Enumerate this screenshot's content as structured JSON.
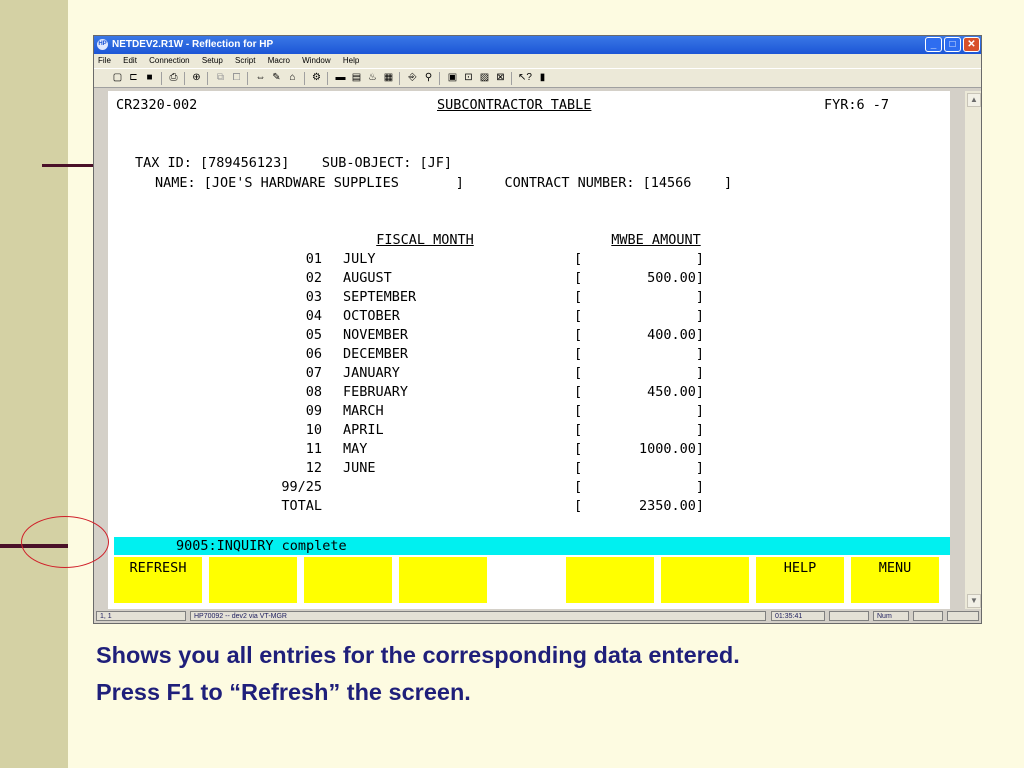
{
  "window": {
    "title": "NETDEV2.R1W - Reflection for HP",
    "app_icon_label": "HP",
    "minimize": "_",
    "maximize": "□",
    "close": "✕"
  },
  "menubar": [
    "File",
    "Edit",
    "Connection",
    "Setup",
    "Script",
    "Macro",
    "Window",
    "Help"
  ],
  "toolbar_icons": [
    "new-icon",
    "open-icon",
    "save-icon",
    "print-icon",
    "find-icon",
    "copy-icon",
    "paste-icon",
    "connect-icon",
    "transfer-icon",
    "receive-icon",
    "settings-icon",
    "display-icon",
    "keyboard-icon",
    "network-icon",
    "hide-icon",
    "macro-icon",
    "record-icon",
    "terminal-icon",
    "screen-icon",
    "help-icon",
    "book-icon"
  ],
  "screen": {
    "screen_id": "CR2320-002",
    "screen_title": "SUBCONTRACTOR TABLE",
    "fyr": "FYR:6 -7",
    "tax_id_line": "TAX ID: [789456123]    SUB-OBJECT: [JF]",
    "name_line": "NAME: [JOE'S HARDWARE SUPPLIES       ]     CONTRACT NUMBER: [14566    ]",
    "col_header_month": "FISCAL MONTH",
    "col_header_amount": "MWBE AMOUNT",
    "rows": [
      {
        "num": "01",
        "month": "JULY",
        "amount": "[              ]"
      },
      {
        "num": "02",
        "month": "AUGUST",
        "amount": "[        500.00]"
      },
      {
        "num": "03",
        "month": "SEPTEMBER",
        "amount": "[              ]"
      },
      {
        "num": "04",
        "month": "OCTOBER",
        "amount": "[              ]"
      },
      {
        "num": "05",
        "month": "NOVEMBER",
        "amount": "[        400.00]"
      },
      {
        "num": "06",
        "month": "DECEMBER",
        "amount": "[              ]"
      },
      {
        "num": "07",
        "month": "JANUARY",
        "amount": "[              ]"
      },
      {
        "num": "08",
        "month": "FEBRUARY",
        "amount": "[        450.00]"
      },
      {
        "num": "09",
        "month": "MARCH",
        "amount": "[              ]"
      },
      {
        "num": "10",
        "month": "APRIL",
        "amount": "[              ]"
      },
      {
        "num": "11",
        "month": "MAY",
        "amount": "[       1000.00]"
      },
      {
        "num": "12",
        "month": "JUNE",
        "amount": "[              ]"
      },
      {
        "num": "99/25",
        "month": "",
        "amount": "[              ]"
      },
      {
        "num": "TOTAL",
        "month": "",
        "amount": "[       2350.00]"
      }
    ],
    "status_message": "9005:INQUIRY complete"
  },
  "function_keys": [
    "REFRESH",
    "",
    "",
    "",
    "",
    "",
    "",
    "HELP",
    "MENU"
  ],
  "statusbar": {
    "position": "1, 1",
    "connection": "HP70092 -- dev2 via VT-MGR",
    "time": "01:35:41",
    "num": "Num"
  },
  "caption": {
    "line1": "Shows you all entries for the corresponding data entered.",
    "line2": "Press F1 to “Refresh” the screen."
  },
  "colors": {
    "slide_background": "#fdfbe1",
    "status_line": "#00f0f0",
    "function_key": "#ffff00",
    "caption_text": "#1f1f7a",
    "highlight_circle": "#d0202a"
  }
}
